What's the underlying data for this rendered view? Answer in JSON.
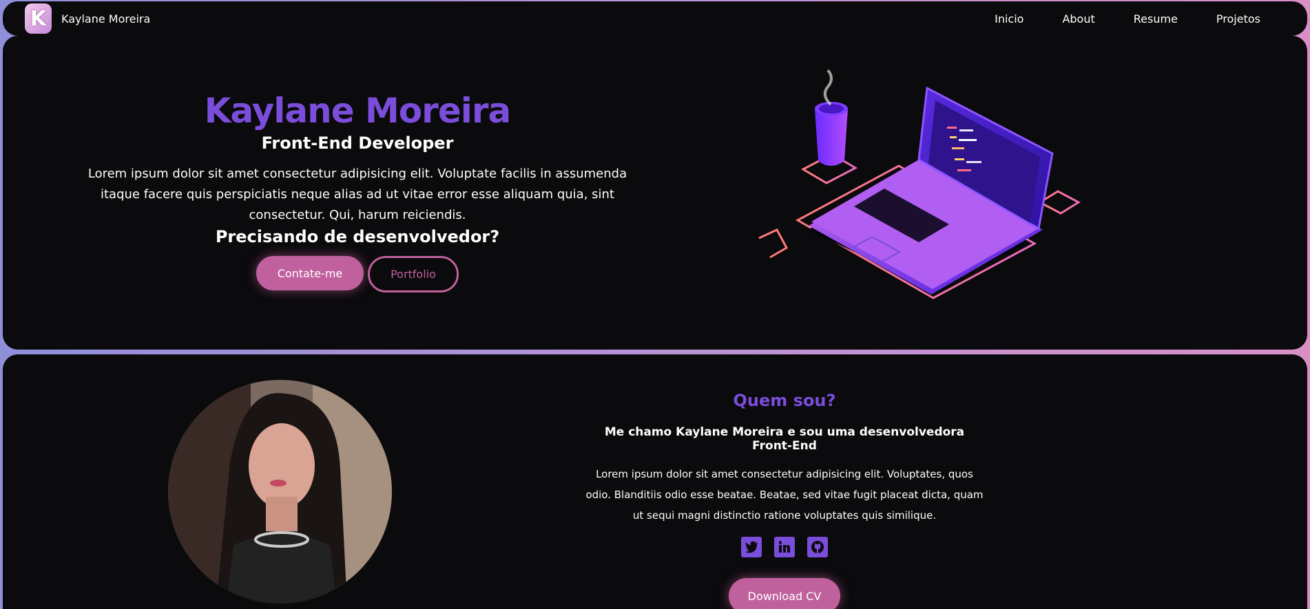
{
  "nav": {
    "brand": "Kaylane Moreira",
    "logo_letter": "K",
    "links": [
      "Inicio",
      "About",
      "Resume",
      "Projetos"
    ]
  },
  "hero": {
    "name": "Kaylane Moreira",
    "role": "Front-End Developer",
    "description": "Lorem ipsum dolor sit amet consectetur adipisicing elit. Voluptate facilis in assumenda itaque facere quis perspiciatis neque alias ad ut vitae error esse aliquam quia, sint consectetur. Qui, harum reiciendis.",
    "question": "Precisando de desenvolvedor?",
    "contact_label": "Contate-me",
    "portfolio_label": "Portfolio"
  },
  "about": {
    "title": "Quem sou?",
    "subtitle": "Me chamo Kaylane Moreira e sou uma desenvolvedora Front-End",
    "description": "Lorem ipsum dolor sit amet consectetur adipisicing elit. Voluptates, quos odio. Blanditiis odio esse beatae. Beatae, sed vitae fugit placeat dicta, quam ut sequi magni distinctio ratione voluptates quis similique.",
    "socials": [
      "twitter-icon",
      "linkedin-icon",
      "github-icon"
    ],
    "cv_label": "Download CV"
  },
  "colors": {
    "accent_purple": "#7b4ddb",
    "accent_pink": "#c0619e",
    "panel_bg": "#0b0a0c"
  }
}
